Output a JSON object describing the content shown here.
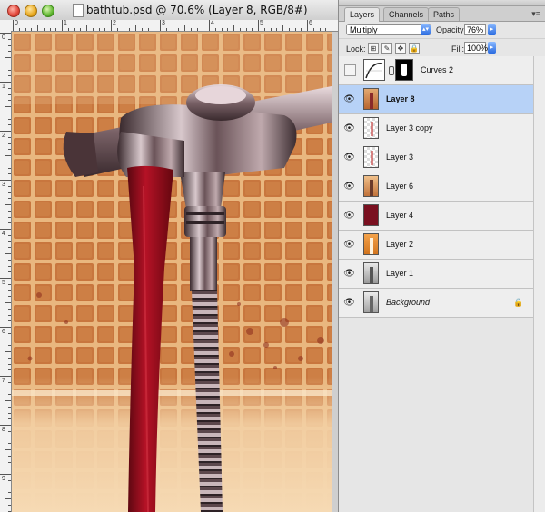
{
  "document": {
    "title": "bathtub.psd @ 70.6% (Layer 8, RGB/8#)",
    "ruler_h_numbers": [
      "0",
      "1",
      "2",
      "3",
      "4",
      "5",
      "6"
    ],
    "ruler_v_numbers": [
      "0",
      "1",
      "2",
      "3",
      "4",
      "5",
      "6",
      "7",
      "8",
      "9"
    ]
  },
  "panel": {
    "tabs": [
      {
        "label": "Layers",
        "active": true
      },
      {
        "label": "Channels",
        "active": false
      },
      {
        "label": "Paths",
        "active": false
      }
    ],
    "menu_icon": "panel-menu-icon",
    "blend_mode": "Multiply",
    "opacity_label": "Opacity:",
    "opacity_value": "76%",
    "lock_label": "Lock:",
    "fill_label": "Fill:",
    "fill_value": "100%"
  },
  "layers": [
    {
      "name": "Curves 2",
      "visible": false,
      "selected": false,
      "kind": "adjustment"
    },
    {
      "name": "Layer 8",
      "visible": true,
      "selected": true,
      "kind": "photo-orange"
    },
    {
      "name": "Layer 3 copy",
      "visible": true,
      "selected": false,
      "kind": "checker"
    },
    {
      "name": "Layer 3",
      "visible": true,
      "selected": false,
      "kind": "checker"
    },
    {
      "name": "Layer 6",
      "visible": true,
      "selected": false,
      "kind": "photo-orange"
    },
    {
      "name": "Layer 4",
      "visible": true,
      "selected": false,
      "kind": "solid-red"
    },
    {
      "name": "Layer 2",
      "visible": true,
      "selected": false,
      "kind": "photo-orange-bright"
    },
    {
      "name": "Layer 1",
      "visible": true,
      "selected": false,
      "kind": "photo-gray"
    },
    {
      "name": "Background",
      "visible": true,
      "selected": false,
      "kind": "photo-gray",
      "locked": true
    }
  ],
  "colors": {
    "selection": "#b7d2f7",
    "accent_blue": "#2a6be0",
    "blood_red": "#8a0f1c",
    "tile_orange": "#c8763e"
  }
}
